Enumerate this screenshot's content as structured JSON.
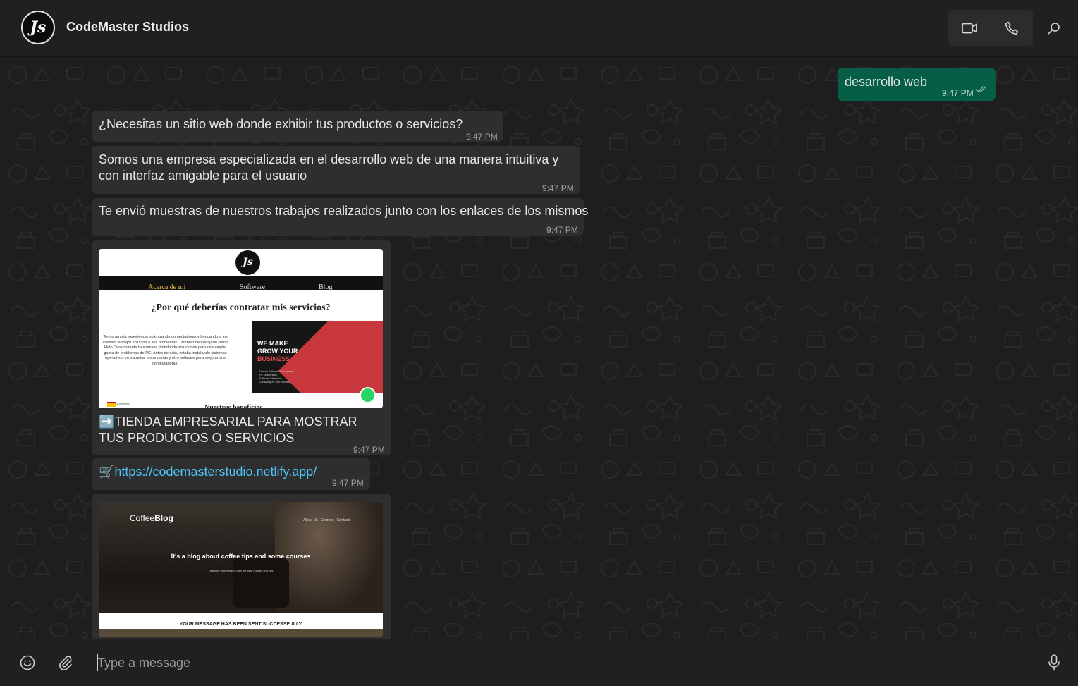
{
  "header": {
    "avatar_text": "Js",
    "contact_name": "CodeMaster Studios",
    "icons": [
      "video-call-icon",
      "voice-call-icon",
      "search-icon"
    ]
  },
  "messages": [
    {
      "direction": "outgoing",
      "text": "desarrollo web",
      "time": "9:47 PM",
      "status": "read"
    },
    {
      "direction": "incoming",
      "text": "¿Necesitas un sitio web donde exhibir tus productos o servicios?",
      "time": "9:47 PM"
    },
    {
      "direction": "incoming",
      "text": "Somos una empresa especializada en el desarrollo web de una manera intuitiva y con interfaz amigable para el usuario",
      "time": "9:47 PM"
    },
    {
      "direction": "incoming",
      "text": "Te envió muestras de nuestros trabajos realizados junto con los enlaces de los mismos",
      "time": "9:47 PM"
    },
    {
      "direction": "incoming",
      "type": "image",
      "caption_emoji": "➡️",
      "caption": "TIENDA EMPRESARIAL PARA MOSTRAR TUS PRODUCTOS O SERVICIOS",
      "time": "9:47 PM",
      "preview": {
        "logo": "Js",
        "nav": [
          "Acerca de mí",
          "Software",
          "Blog"
        ],
        "heading": "¿Por qué deberías contratar mis servicios?",
        "body": "Tengo amplia experiencia optimizando computadoras y brindando a los clientes la mejor solución a sus problemas. También he trabajado como Help Desk durante tres meses, brindando soluciones para una amplia gama de problemas de PC. Antes de esto, estaba instalando sistemas operativos en escuelas secundarias y otro software para mejorar sus computadoras.",
        "banner": [
          "WE MAKE",
          "GROW YOUR",
          "BUSINESS"
        ],
        "banner_list": [
          "Custom Software Development",
          "PC Optimization",
          "Software Installation",
          "Consulting for your business"
        ],
        "language": "Español",
        "footer_heading": "Nuestros beneficios"
      }
    },
    {
      "direction": "incoming",
      "emoji": "🛒",
      "link": "https://codemasterstudio.netlify.app/",
      "time": "9:47 PM"
    },
    {
      "direction": "incoming",
      "type": "image",
      "preview": {
        "brand_light": "Coffee",
        "brand_bold": "Blog",
        "nav": [
          "About Us",
          "Courses",
          "Contacts"
        ],
        "headline": "It's a blog about coffee tips and some courses",
        "subline": "Learning from experts with the best recipes and tips",
        "notice": "YOUR MESSAGE HAS BEEN SENT SUCCESSFULLY"
      }
    }
  ],
  "composer": {
    "placeholder": "Type a message",
    "icons": [
      "emoji-icon",
      "attach-icon",
      "microphone-icon"
    ]
  },
  "colors": {
    "header_bg": "#202020",
    "chat_bg": "#1e1e1e",
    "incoming_bubble": "#2e2e2e",
    "outgoing_bubble": "#075e46",
    "link": "#4fc3f7",
    "read_ticks": "#8fb9ad"
  }
}
